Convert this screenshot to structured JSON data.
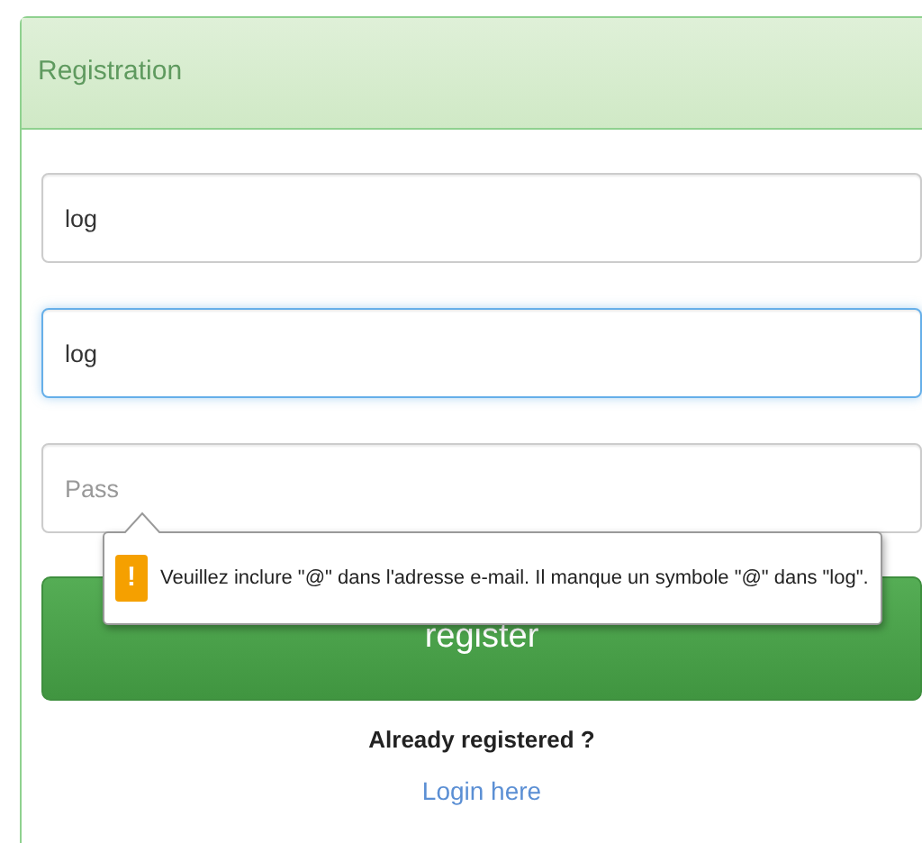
{
  "panel": {
    "title": "Registration"
  },
  "fields": [
    {
      "value": "log",
      "focused": false
    },
    {
      "value": "log",
      "focused": true
    },
    {
      "placeholder": "Pass",
      "focused": false
    }
  ],
  "tooltip": {
    "icon": "!",
    "message": "Veuillez inclure \"@\" dans l'adresse e-mail. Il manque un symbole \"@\" dans \"log\"."
  },
  "button": {
    "label": "register"
  },
  "prompt": "Already registered ?",
  "link": "Login here"
}
